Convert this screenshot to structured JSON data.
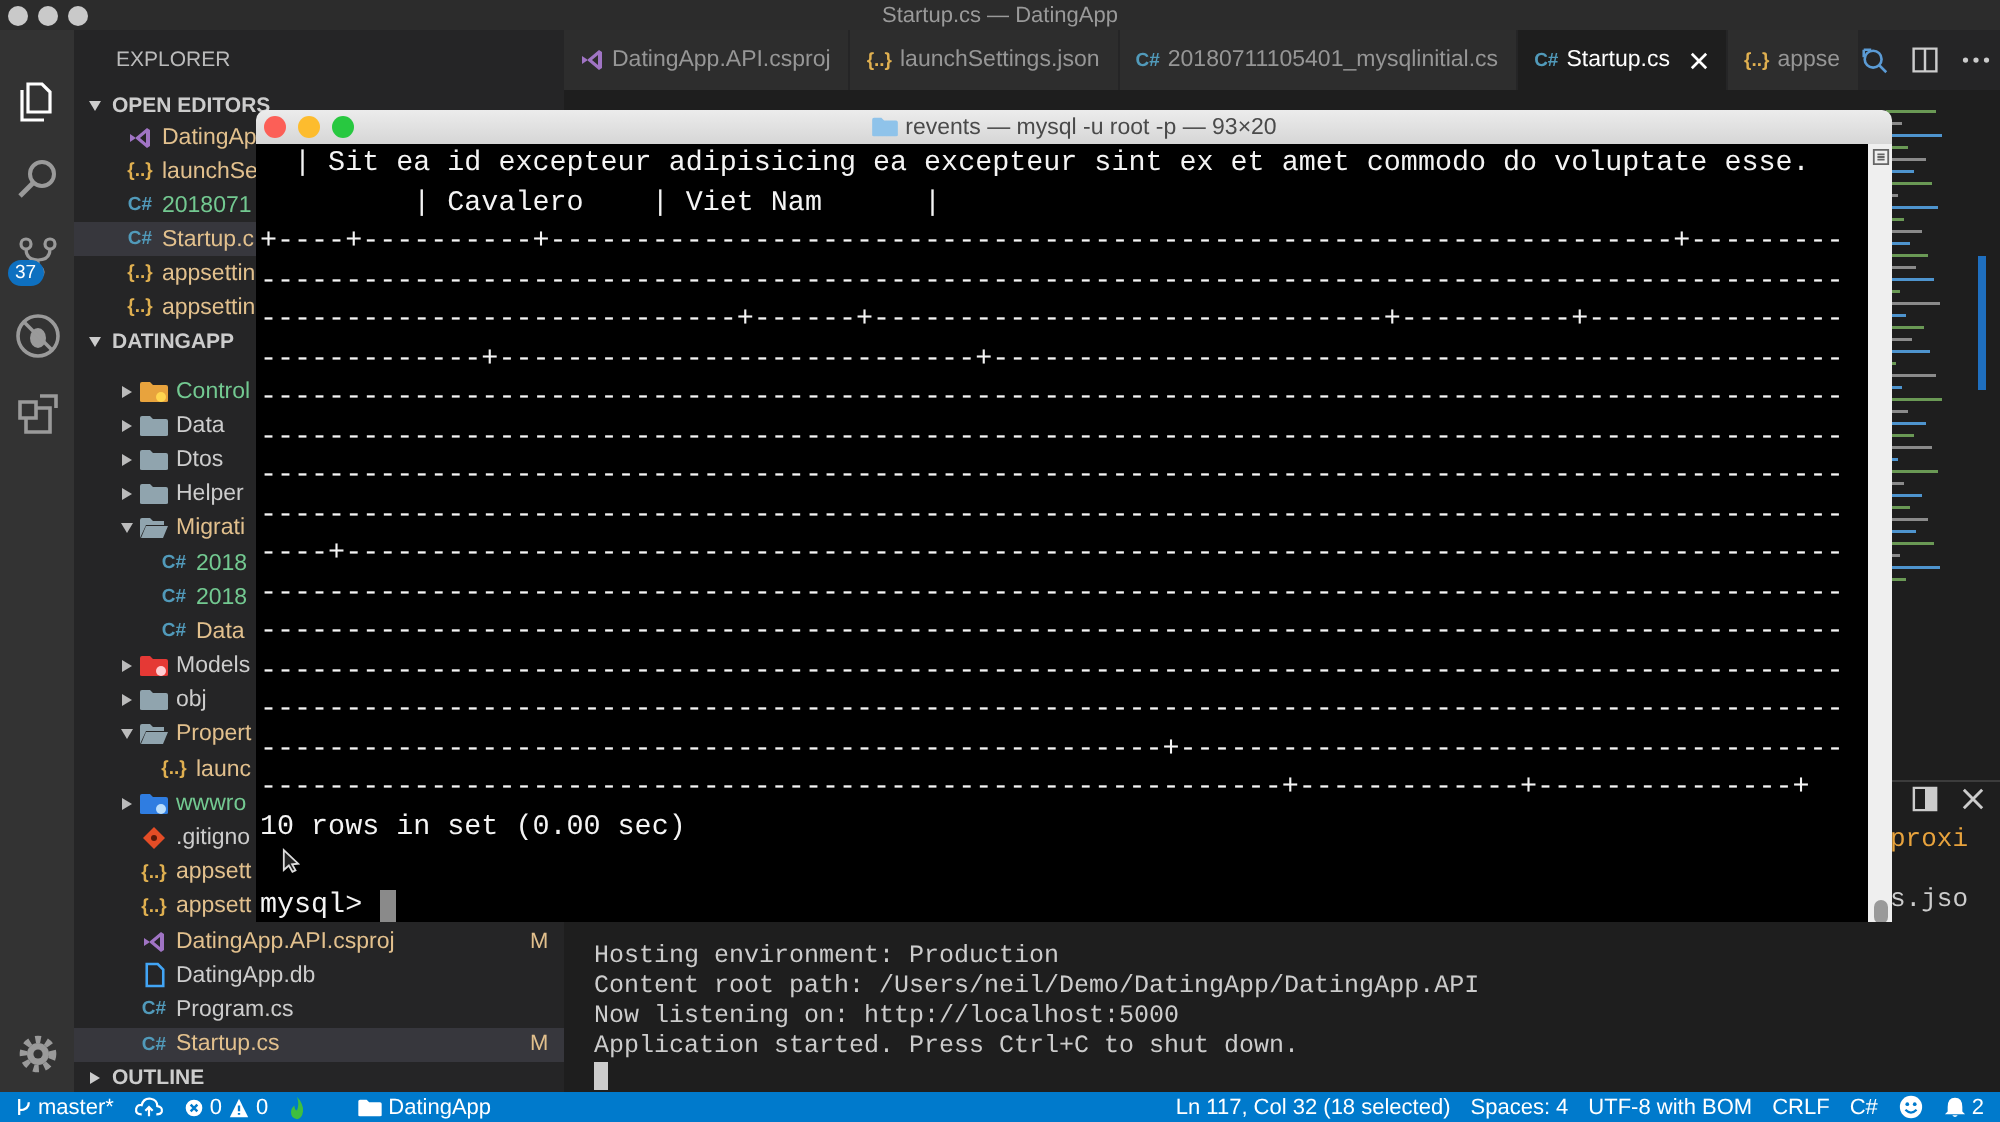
{
  "window": {
    "title": "Startup.cs — DatingApp"
  },
  "activity_bar": {
    "scm_badge": "37"
  },
  "sidebar": {
    "header": "EXPLORER",
    "open_editors": {
      "title": "OPEN EDITORS",
      "expanded": true,
      "items": [
        {
          "label": "DatingAp",
          "kind": "csproj",
          "color": "#e2c08d",
          "selected": false
        },
        {
          "label": "launchSe",
          "kind": "json",
          "glyph": "{..}",
          "color": "#e2c08d",
          "selected": false
        },
        {
          "label": "2018071",
          "kind": "cs",
          "glyph": "C#",
          "color": "#73c991",
          "selected": false
        },
        {
          "label": "Startup.c",
          "kind": "cs",
          "glyph": "C#",
          "color": "#e2c08d",
          "selected": true
        },
        {
          "label": "appsettin",
          "kind": "json",
          "glyph": "{..}",
          "color": "#e2c08d",
          "selected": false
        },
        {
          "label": "appsettin",
          "kind": "json",
          "glyph": "{..}",
          "color": "#e2c08d",
          "selected": false
        }
      ]
    },
    "project": {
      "title": "DATINGAPP",
      "expanded": true,
      "items": [
        {
          "label": "Control",
          "kind": "folder-controllers",
          "color": "#73c991",
          "expanded": false,
          "selected": false
        },
        {
          "label": "Data",
          "kind": "folder",
          "color": "#cccccc",
          "expanded": false,
          "selected": false
        },
        {
          "label": "Dtos",
          "kind": "folder",
          "color": "#cccccc",
          "expanded": false,
          "selected": false
        },
        {
          "label": "Helper",
          "kind": "folder",
          "color": "#cccccc",
          "expanded": false,
          "selected": false
        },
        {
          "label": "Migrati",
          "kind": "folder",
          "color": "#e2c08d",
          "expanded": true,
          "selected": false,
          "children": [
            {
              "label": "2018",
              "kind": "cs",
              "glyph": "C#",
              "color": "#73c991",
              "selected": false
            },
            {
              "label": "2018",
              "kind": "cs",
              "glyph": "C#",
              "color": "#73c991",
              "selected": false
            },
            {
              "label": "Data",
              "kind": "cs",
              "glyph": "C#",
              "color": "#e2c08d",
              "selected": false
            }
          ]
        },
        {
          "label": "Models",
          "kind": "folder-models",
          "color": "#cccccc",
          "expanded": false,
          "selected": false
        },
        {
          "label": "obj",
          "kind": "folder",
          "color": "#cccccc",
          "expanded": false,
          "selected": false
        },
        {
          "label": "Propert",
          "kind": "folder",
          "color": "#e2c08d",
          "expanded": true,
          "selected": false,
          "children": [
            {
              "label": "launc",
              "kind": "json",
              "glyph": "{..}",
              "color": "#e2c08d",
              "selected": false
            }
          ]
        },
        {
          "label": "wwwro",
          "kind": "folder-www",
          "color": "#73c991",
          "expanded": false,
          "selected": false
        },
        {
          "label": ".gitigno",
          "kind": "git",
          "color": "#cccccc",
          "selected": false
        },
        {
          "label": "appsett",
          "kind": "json",
          "glyph": "{..}",
          "color": "#e2c08d",
          "selected": false
        },
        {
          "label": "appsett",
          "kind": "json",
          "glyph": "{..}",
          "color": "#e2c08d",
          "selected": false
        },
        {
          "label": "DatingApp.API.csproj",
          "kind": "csproj",
          "color": "#e2c08d",
          "badge": "M",
          "selected": false
        },
        {
          "label": "DatingApp.db",
          "kind": "file",
          "color": "#cccccc",
          "selected": false
        },
        {
          "label": "Program.cs",
          "kind": "cs",
          "glyph": "C#",
          "color": "#cccccc",
          "selected": false
        },
        {
          "label": "Startup.cs",
          "kind": "cs",
          "glyph": "C#",
          "color": "#e2c08d",
          "badge": "M",
          "selected": true
        }
      ]
    },
    "outline": {
      "title": "OUTLINE",
      "expanded": false
    }
  },
  "tabs": [
    {
      "label": "DatingApp.API.csproj",
      "kind": "csproj",
      "selected": false
    },
    {
      "label": "launchSettings.json",
      "kind": "json",
      "glyph": "{..}",
      "selected": false
    },
    {
      "label": "20180711105401_mysqlinitial.cs",
      "kind": "cs",
      "glyph": "C#",
      "selected": false
    },
    {
      "label": "Startup.cs",
      "kind": "cs",
      "glyph": "C#",
      "selected": true
    },
    {
      "label": "appse",
      "kind": "json",
      "glyph": "{..}",
      "selected": false
    }
  ],
  "panel": {
    "lines": [
      "Hosting environment: Production",
      "Content root path: /Users/neil/Demo/DatingApp/DatingApp.API",
      "Now listening on: http://localhost:5000",
      "Application started. Press Ctrl+C to shut down."
    ],
    "side_fragments": [
      {
        "text": "proxi",
        "kind": "key"
      },
      {
        "text": "s.jso",
        "kind": "plain"
      }
    ]
  },
  "terminal_window": {
    "title": "revents — mysql -u root -p — 93×20",
    "lines": [
      "  | Sit ea id excepteur adipisicing ea excepteur sint ex et amet commodo do voluptate esse.",
      "         | Cavalero    | Viet Nam      |",
      "+----+----------+------------------------------------------------------------------+---------",
      "---------------------------------------------------------------------------------------------",
      "----------------------------+------+------------------------------+----------+---------------",
      "-------------+----------------------------+--------------------------------------------------",
      "---------------------------------------------------------------------------------------------",
      "---------------------------------------------------------------------------------------------",
      "---------------------------------------------------------------------------------------------",
      "---------------------------------------------------------------------------------------------",
      "----+----------------------------------------------------------------------------------------",
      "---------------------------------------------------------------------------------------------",
      "---------------------------------------------------------------------------------------------",
      "---------------------------------------------------------------------------------------------",
      "---------------------------------------------------------------------------------------------",
      "-----------------------------------------------------+---------------------------------------",
      "------------------------------------------------------------+-------------+---------------+",
      "10 rows in set (0.00 sec)"
    ],
    "prompt": "mysql>"
  },
  "status_bar": {
    "branch": "master*",
    "errors": "0",
    "warnings": "0",
    "folder": "DatingApp",
    "position": "Ln 117, Col 32 (18 selected)",
    "indentation": "Spaces: 4",
    "encoding": "UTF-8 with BOM",
    "line_ending": "CRLF",
    "language": "C#",
    "notifications": "2"
  }
}
